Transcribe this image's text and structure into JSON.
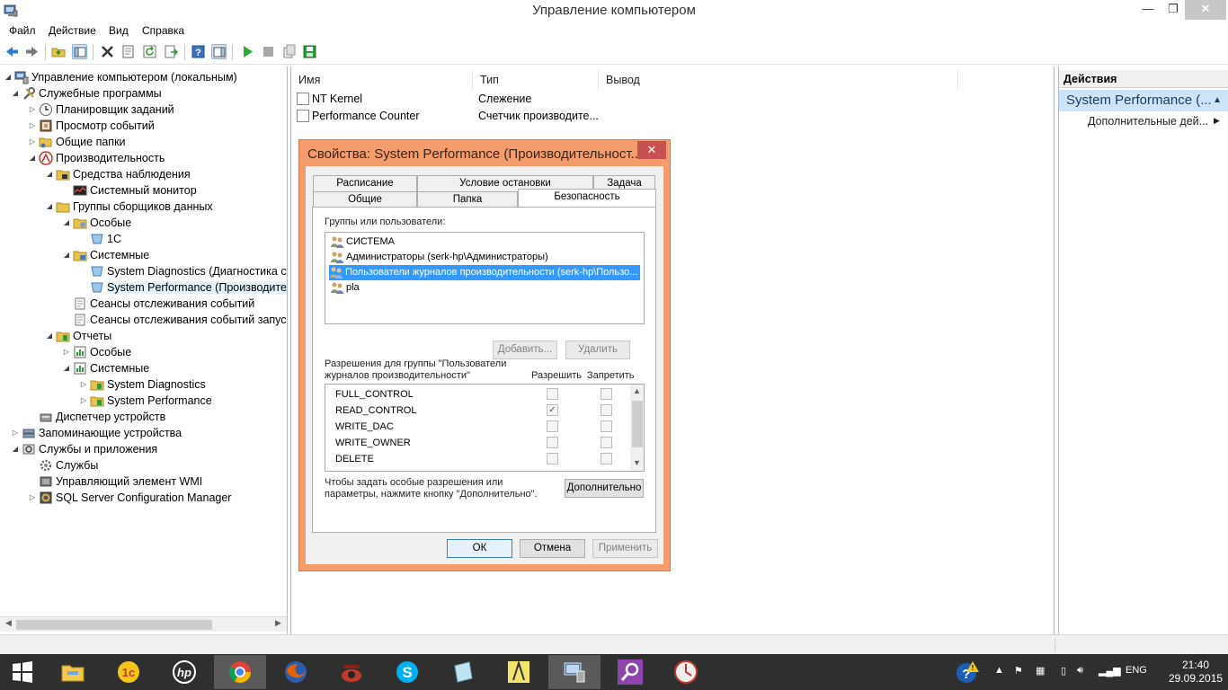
{
  "window": {
    "title": "Управление компьютером",
    "min_glyph": "—",
    "max_glyph": "❐",
    "close_glyph": "✕"
  },
  "menu": [
    "Файл",
    "Действие",
    "Вид",
    "Справка"
  ],
  "tree": {
    "items": [
      {
        "label": "Управление компьютером (локальным)",
        "icon": "computer-management-icon"
      },
      {
        "label": "Служебные программы",
        "icon": "tools-icon"
      },
      {
        "label": "Планировщик заданий",
        "icon": "clock-icon"
      },
      {
        "label": "Просмотр событий",
        "icon": "event-viewer-icon"
      },
      {
        "label": "Общие папки",
        "icon": "shared-folder-icon"
      },
      {
        "label": "Производительность",
        "icon": "performance-icon"
      },
      {
        "label": "Средства наблюдения",
        "icon": "folder-icon"
      },
      {
        "label": "Системный монитор",
        "icon": "monitor-icon"
      },
      {
        "label": "Группы сборщиков данных",
        "icon": "folder-icon"
      },
      {
        "label": "Особые",
        "icon": "folder-icon"
      },
      {
        "label": "1С",
        "icon": "collector-icon"
      },
      {
        "label": "Системные",
        "icon": "folder-icon"
      },
      {
        "label": "System Diagnostics (Диагностика системы)",
        "icon": "collector-icon"
      },
      {
        "label": "System Performance (Производительность системы)",
        "icon": "collector-icon"
      },
      {
        "label": "Сеансы отслеживания событий",
        "icon": "trace-icon"
      },
      {
        "label": "Сеансы отслеживания событий запуска",
        "icon": "trace-icon"
      },
      {
        "label": "Отчеты",
        "icon": "folder-icon"
      },
      {
        "label": "Особые",
        "icon": "report-icon"
      },
      {
        "label": "Системные",
        "icon": "report-icon"
      },
      {
        "label": "System Diagnostics",
        "icon": "folder-icon"
      },
      {
        "label": "System Performance",
        "icon": "folder-icon"
      },
      {
        "label": "Диспетчер устройств",
        "icon": "device-manager-icon"
      },
      {
        "label": "Запоминающие устройства",
        "icon": "storage-icon"
      },
      {
        "label": "Службы и приложения",
        "icon": "services-apps-icon"
      },
      {
        "label": "Службы",
        "icon": "gear-icon"
      },
      {
        "label": "Управляющий элемент WMI",
        "icon": "wmi-icon"
      },
      {
        "label": "SQL Server Configuration Manager",
        "icon": "sql-icon"
      }
    ]
  },
  "list": {
    "columns": [
      "Имя",
      "Тип",
      "Вывод"
    ],
    "rows": [
      {
        "name": "NT Kernel",
        "type": "Слежение",
        "output": ""
      },
      {
        "name": "Performance Counter",
        "type": "Счетчик производите...",
        "output": ""
      }
    ]
  },
  "actions": {
    "header": "Действия",
    "group": "System Performance (...",
    "item": "Дополнительные дей..."
  },
  "dialog": {
    "title": "Свойства: System Performance (Производительност...",
    "tabs_row1": [
      "Расписание",
      "Условие остановки",
      "Задача"
    ],
    "tabs_row2": [
      "Общие",
      "Папка",
      "Безопасность"
    ],
    "groups_label": "Группы или пользователи:",
    "users": [
      "СИСТЕМА",
      "Администраторы (serk-hp\\Администраторы)",
      "Пользователи журналов производительности (serk-hp\\Пользо...",
      "pla"
    ],
    "add_button": "Добавить...",
    "remove_button": "Удалить",
    "perm_label_line1": "Разрешения для группы \"Пользователи",
    "perm_label_line2": "журналов производительности\"",
    "allow_header": "Разрешить",
    "deny_header": "Запретить",
    "permissions": [
      {
        "name": "FULL_CONTROL",
        "allow": false,
        "deny": false
      },
      {
        "name": "READ_CONTROL",
        "allow": true,
        "deny": false
      },
      {
        "name": "WRITE_DAC",
        "allow": false,
        "deny": false
      },
      {
        "name": "WRITE_OWNER",
        "allow": false,
        "deny": false
      },
      {
        "name": "DELETE",
        "allow": false,
        "deny": false
      }
    ],
    "advanced_hint_line1": "Чтобы задать особые разрешения или",
    "advanced_hint_line2": "параметры, нажмите кнопку \"Дополнительно\".",
    "advanced_button": "Дополнительно",
    "ok_button": "ОК",
    "cancel_button": "Отмена",
    "apply_button": "Применить"
  },
  "taskbar": {
    "apps": [
      "start",
      "file-explorer",
      "1c",
      "hp",
      "chrome",
      "firefox",
      "phone",
      "skype",
      "notes",
      "pencil",
      "computer-management",
      "search",
      "clock-app"
    ],
    "language": "ENG",
    "time": "21:40",
    "date": "29.09.2015"
  },
  "colors": {
    "dialog_frame": "#f59c6c",
    "selection": "#3399ff",
    "actions_group": "#cce4f7",
    "taskbar": "#2f2f2f"
  }
}
